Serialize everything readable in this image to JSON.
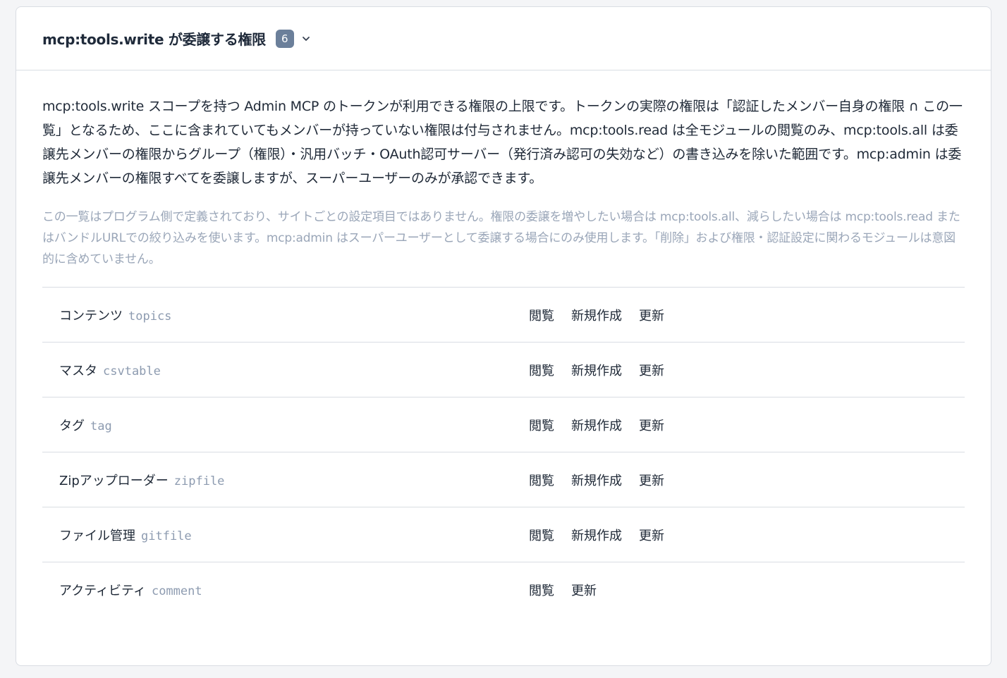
{
  "header": {
    "title": "mcp:tools.write が委譲する権限",
    "count": "6"
  },
  "description": "mcp:tools.write スコープを持つ Admin MCP のトークンが利用できる権限の上限です。トークンの実際の権限は「認証したメンバー自身の権限 ∩ この一覧」となるため、ここに含まれていてもメンバーが持っていない権限は付与されません。mcp:tools.read は全モジュールの閲覧のみ、mcp:tools.all は委譲先メンバーの権限からグループ（権限）・汎用バッチ・OAuth認可サーバー（発行済み認可の失効など）の書き込みを除いた範囲です。mcp:admin は委譲先メンバーの権限すべてを委譲しますが、スーパーユーザーのみが承認できます。",
  "note": "この一覧はプログラム側で定義されており、サイトごとの設定項目ではありません。権限の委譲を増やしたい場合は mcp:tools.all、減らしたい場合は mcp:tools.read またはバンドルURLでの絞り込みを使います。mcp:admin はスーパーユーザーとして委譲する場合にのみ使用します。「削除」および権限・認証設定に関わるモジュールは意図的に含めていません。",
  "modules": [
    {
      "name": "コンテンツ",
      "code": "topics",
      "actions": [
        "閲覧",
        "新規作成",
        "更新"
      ]
    },
    {
      "name": "マスタ",
      "code": "csvtable",
      "actions": [
        "閲覧",
        "新規作成",
        "更新"
      ]
    },
    {
      "name": "タグ",
      "code": "tag",
      "actions": [
        "閲覧",
        "新規作成",
        "更新"
      ]
    },
    {
      "name": "Zipアップローダー",
      "code": "zipfile",
      "actions": [
        "閲覧",
        "新規作成",
        "更新"
      ]
    },
    {
      "name": "ファイル管理",
      "code": "gitfile",
      "actions": [
        "閲覧",
        "新規作成",
        "更新"
      ]
    },
    {
      "name": "アクティビティ",
      "code": "comment",
      "actions": [
        "閲覧",
        "更新"
      ]
    }
  ],
  "icons": {
    "expand": "chevron-down-icon"
  },
  "colors": {
    "badge": "#6b7f9a",
    "note_text": "#9aa6b8",
    "code_text": "#8d9bb0",
    "border": "#d9dde3"
  }
}
